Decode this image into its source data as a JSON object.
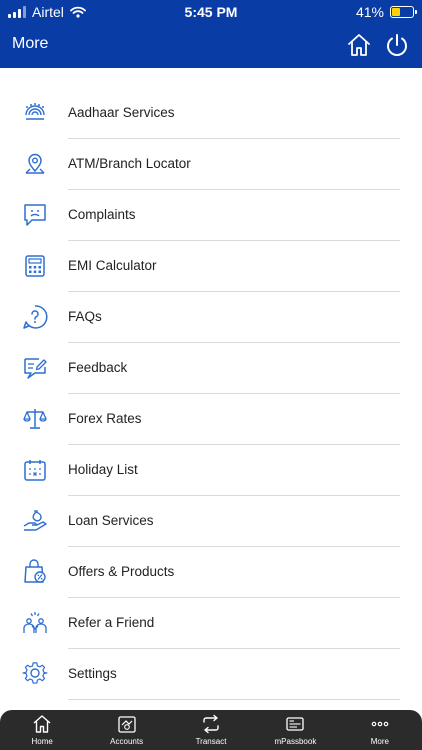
{
  "status_bar": {
    "carrier": "Airtel",
    "time": "5:45 PM",
    "battery": "41%",
    "battery_level": 0.41,
    "icons": [
      "signal-icon",
      "wifi-icon",
      "battery-icon"
    ]
  },
  "header": {
    "title": "More",
    "icons": [
      "home-icon",
      "power-icon"
    ]
  },
  "menu": {
    "items": [
      {
        "label": "Aadhaar Services",
        "icon": "aadhaar-icon"
      },
      {
        "label": "ATM/Branch Locator",
        "icon": "location-pin-icon"
      },
      {
        "label": "Complaints",
        "icon": "complaint-icon"
      },
      {
        "label": "EMI Calculator",
        "icon": "calculator-icon"
      },
      {
        "label": "FAQs",
        "icon": "question-icon"
      },
      {
        "label": "Feedback",
        "icon": "feedback-icon"
      },
      {
        "label": "Forex Rates",
        "icon": "scales-icon"
      },
      {
        "label": "Holiday List",
        "icon": "calendar-icon"
      },
      {
        "label": "Loan Services",
        "icon": "loan-icon"
      },
      {
        "label": "Offers & Products",
        "icon": "offer-bag-icon"
      },
      {
        "label": "Refer a Friend",
        "icon": "refer-icon"
      },
      {
        "label": "Settings",
        "icon": "gear-icon"
      }
    ]
  },
  "tab_bar": {
    "tabs": [
      {
        "label": "Home",
        "icon": "home-icon"
      },
      {
        "label": "Accounts",
        "icon": "accounts-icon"
      },
      {
        "label": "Transact",
        "icon": "transfer-icon"
      },
      {
        "label": "mPassbook",
        "icon": "passbook-icon"
      },
      {
        "label": "More",
        "icon": "more-dots-icon"
      }
    ]
  },
  "colors": {
    "brand": "#0a3ca6",
    "icon": "#2f6fd1",
    "tab_bar": "#2b2b2b",
    "battery_fill": "#ffd400"
  }
}
